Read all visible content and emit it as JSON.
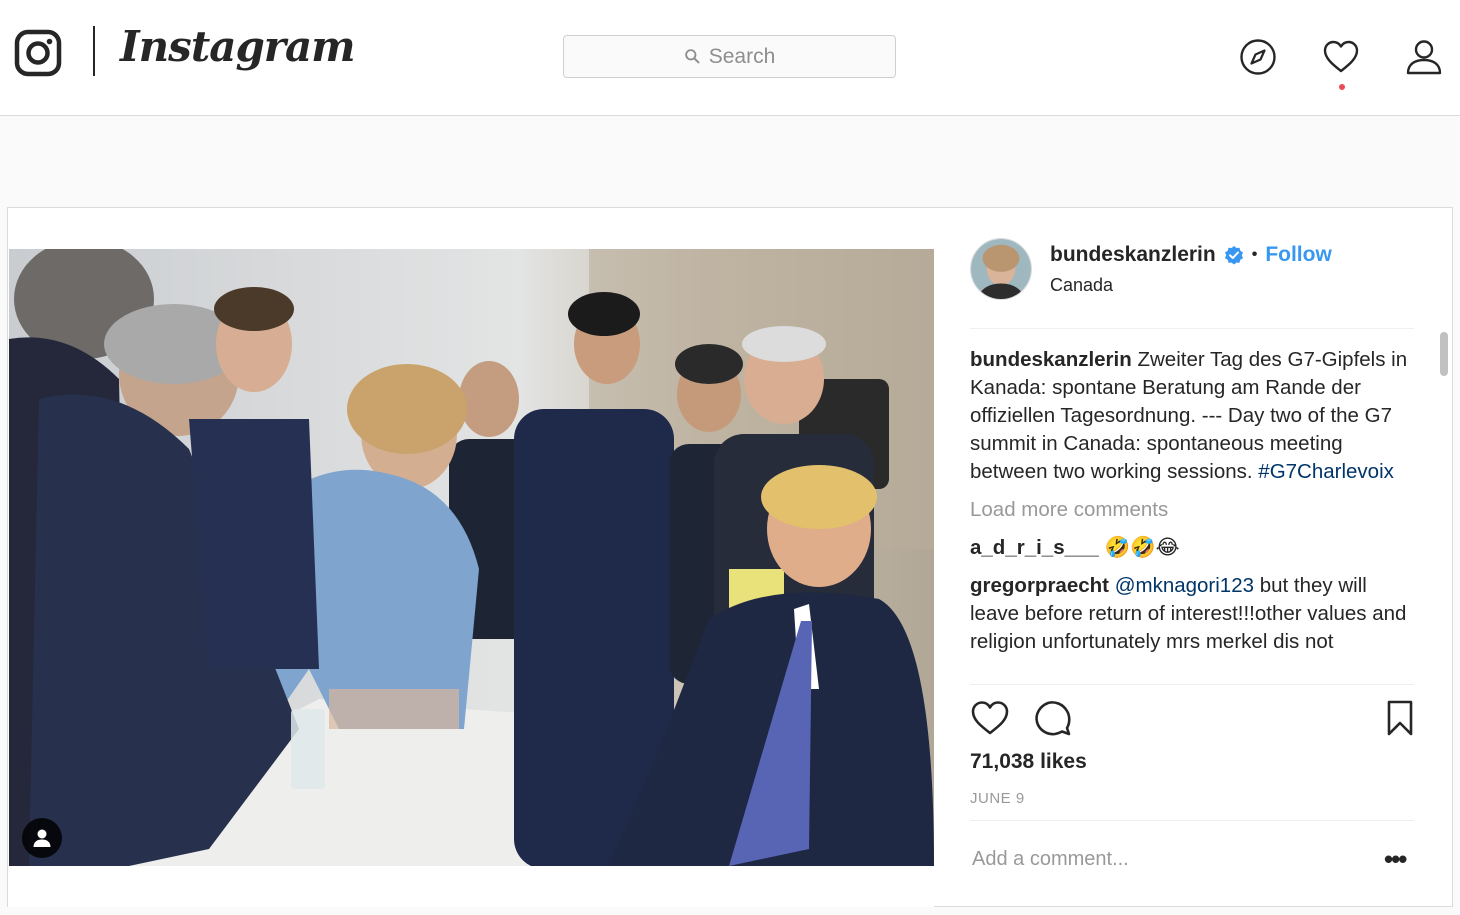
{
  "header": {
    "wordmark": "Instagram",
    "search_placeholder": "Search"
  },
  "icons": {
    "logo": "instagram-glyph-icon",
    "search": "search-icon",
    "explore": "compass-icon",
    "activity": "heart-icon",
    "profile": "person-icon",
    "verified": "verified-badge-icon",
    "like": "heart-outline-icon",
    "comment": "speech-bubble-icon",
    "save": "bookmark-icon",
    "tag": "person-tag-icon"
  },
  "colors": {
    "link": "#3897f0",
    "hashtag": "#003569",
    "notification": "#ed4956"
  },
  "post": {
    "username": "bundeskanzlerin",
    "separator": "•",
    "follow_label": "Follow",
    "location": "Canada",
    "caption_user": "bundeskanzlerin",
    "caption_text": "Zweiter Tag des G7-Gipfels in Kanada: spontane Beratung am Rande der offiziellen Tagesordnung. --- Day two of the G7 summit in Canada: spontaneous meeting between two working sessions.",
    "caption_hashtag": "#G7Charlevoix",
    "load_more": "Load more comments",
    "comments": [
      {
        "user": "a_d_r_i_s___",
        "mention": "",
        "text": "🤣🤣😂"
      },
      {
        "user": "gregorpraecht",
        "mention": "@mknagori123",
        "text": "but they will leave before return of interest!!!other values and religion unfortunately mrs merkel dis not"
      }
    ],
    "likes": "71,038 likes",
    "date": "JUNE 9",
    "add_comment_placeholder": "Add a comment...",
    "more_label": "•••"
  }
}
